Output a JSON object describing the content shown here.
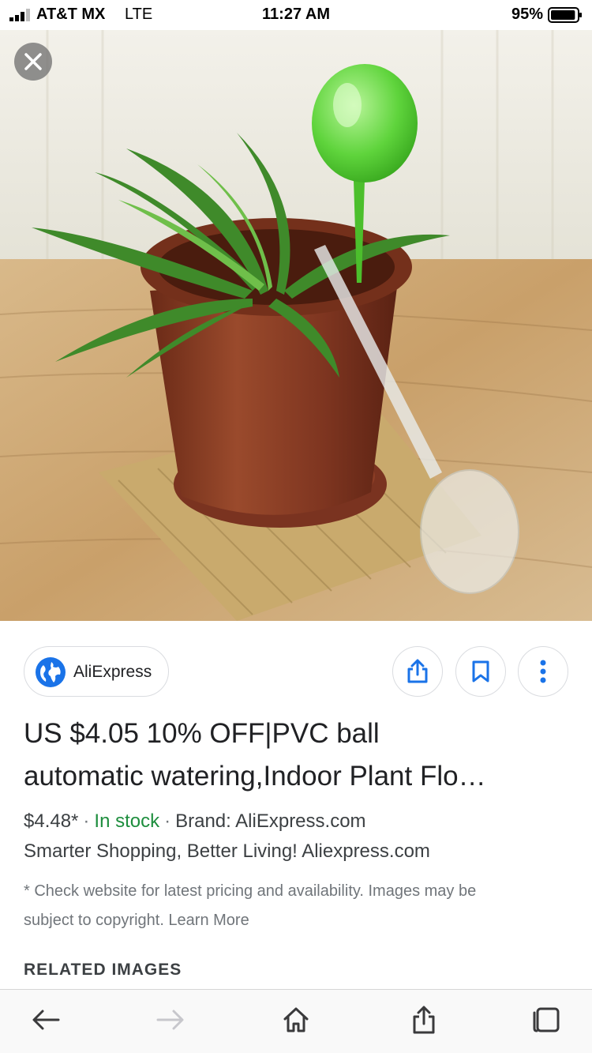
{
  "status_bar": {
    "carrier": "AT&T MX",
    "network": "LTE",
    "time": "11:27 AM",
    "battery_percent": "95%",
    "battery_level": 0.95
  },
  "image_viewer": {
    "close_icon": "close-icon",
    "image_subject": "potted spider plant with green and clear watering globes"
  },
  "source": {
    "name": "AliExpress",
    "icon": "globe-icon"
  },
  "actions": {
    "share_icon": "share-icon",
    "save_icon": "bookmark-icon",
    "more_icon": "more-vert-icon"
  },
  "result": {
    "title_line1": "US $4.05 10% OFF|PVC ball",
    "title_line2": "automatic watering,Indoor Plant Flo…",
    "price": "$4.48*",
    "stock": "In stock",
    "brand": "Brand: AliExpress.com",
    "tagline": "Smarter Shopping, Better Living! Aliexpress.com",
    "disclaimer_line1": "* Check website for latest pricing and availability. Images may be",
    "disclaimer_line2": "subject to copyright. Learn More"
  },
  "related_heading": "RELATED IMAGES",
  "toolbar": {
    "back_icon": "back-arrow-icon",
    "forward_icon": "forward-arrow-icon",
    "home_icon": "home-icon",
    "share_icon": "share-icon",
    "tabs_icon": "tabs-icon"
  },
  "colors": {
    "accent_blue": "#1a73e8",
    "stock_green": "#1e8e3e",
    "text_primary": "#202124",
    "text_secondary": "#70757a"
  }
}
